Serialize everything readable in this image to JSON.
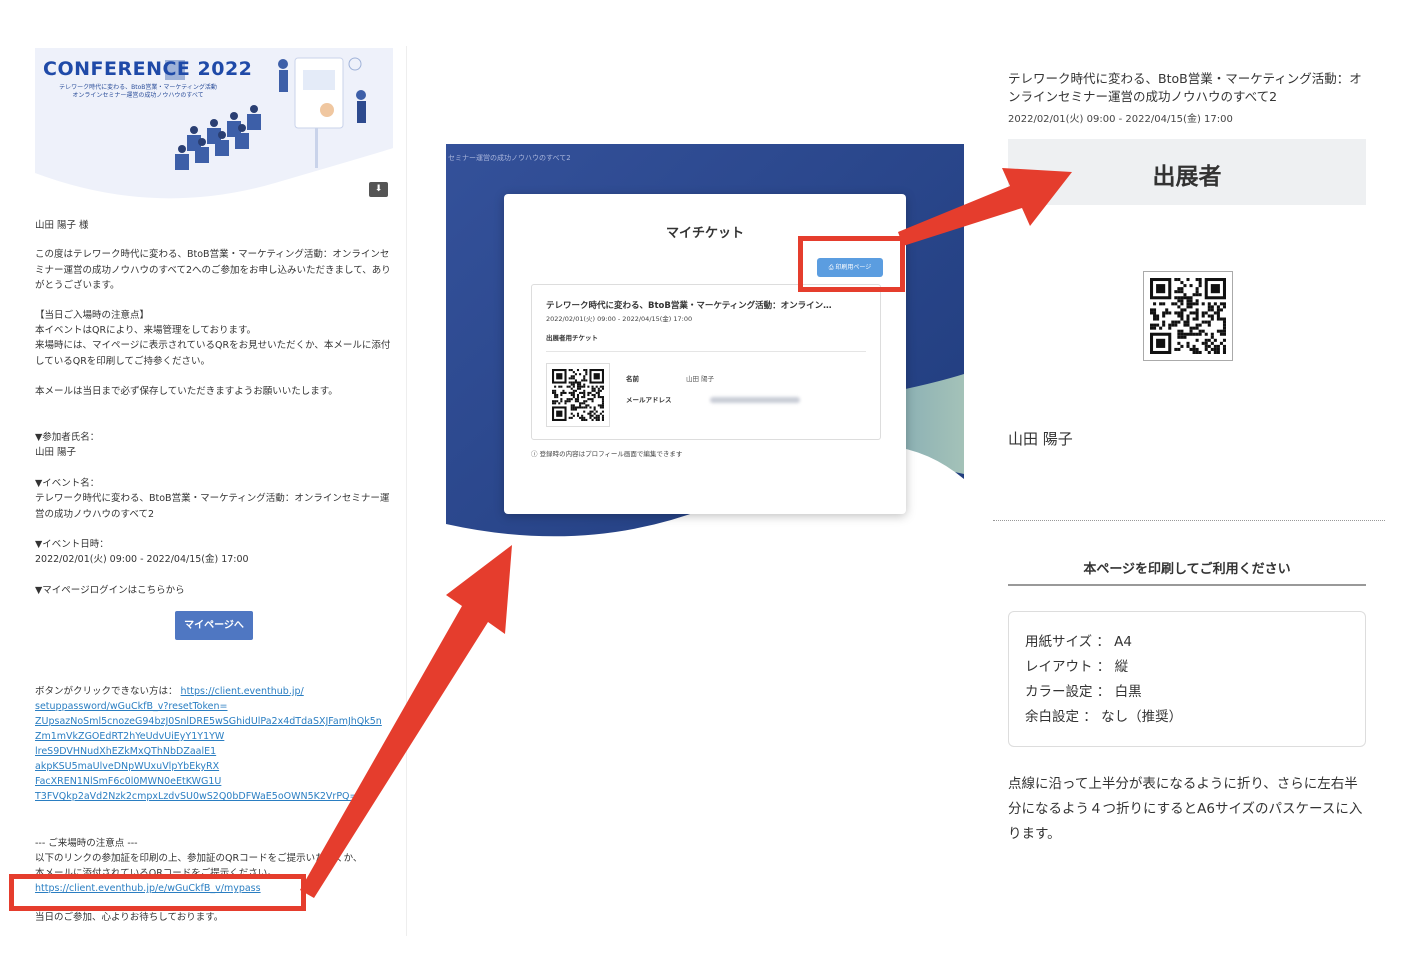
{
  "email": {
    "banner": {
      "title": "CONFERENCE 2022",
      "subtitle_1": "テレワーク時代に変わる、BtoB営業・マーケティング活動",
      "subtitle_2": "オンラインセミナー運営の成功ノウハウのすべて"
    },
    "salutation": "山田 陽子 様",
    "intro": "この度はテレワーク時代に変わる、BtoB営業・マーケティング活動：オンラインセミナー運営の成功ノウハウのすべて2へのご参加をお申し込みいただきまして、ありがとうございます。",
    "notice_heading": "【当日ご入場時の注意点】",
    "notice_line_1": "本イベントはQRにより、来場管理をしております。",
    "notice_line_2": "来場時には、マイページに表示されているQRをお見せいただくか、本メールに添付しているQRを印刷してご持参ください。",
    "keep_mail": "本メールは当日まで必ず保存していただきますようお願いいたします。",
    "participant_label": "▼参加者氏名：",
    "participant_value": "山田 陽子",
    "event_label": "▼イベント名：",
    "event_value": "テレワーク時代に変わる、BtoB営業・マーケティング活動：オンラインセミナー運営の成功ノウハウのすべて2",
    "date_label": "▼イベント日時：",
    "date_value": "2022/02/01(火) 09:00 - 2022/04/15(金) 17:00",
    "login_label": "▼マイページログインはこちらから",
    "mypage_button": "マイページへ",
    "no_click_prefix": "ボタンがクリックできない方は：",
    "reset_url_lines": [
      "https://client.eventhub.jp/",
      "setuppassword/wGuCkfB_v?resetToken=",
      "ZUpsazNoSml5cnozeG94bzJ0SnlDRE5wSGhidUlPa2x4dTdaSXJFamJhQk5n",
      "Zm1mVkZGOEdRT2hYeUdvUiEyY1Y1YW",
      "lreS9DVHNudXhEZkMxQThNbDZaalE1",
      "akpKSU5maUlveDNpWUxuVlpYbEkyRX",
      "FacXREN1NlSmF6c0l0MWN0eEtKWG1U",
      "T3FVQkp2aVd2Nzk2cmpxLzdvSU0wS2Q0bDFWaE5oOWN5K2VrPQ=="
    ],
    "visit_heading": "--- ご来場時の注意点 ---",
    "visit_line_1": "以下のリンクの参加証を印刷の上、参加証のQRコードをご提示いただくか、",
    "visit_line_2": "本メールに添付されているQRコードをご提示ください。",
    "mypass_url": "https://client.eventhub.jp/e/wGuCkfB_v/mypass",
    "closing": "当日のご参加、心よりお待ちしております。"
  },
  "ticket": {
    "breadcrumb": "セミナー運営の成功ノウハウのすべて2",
    "title": "マイチケット",
    "print_button": "印刷用ページ",
    "event_name": "テレワーク時代に変わる、BtoB営業・マーケティング活動：オンライン…",
    "event_date": "2022/02/01(火) 09:00 - 2022/04/15(金) 17:00",
    "ticket_type": "出展者用チケット",
    "name_label": "名前",
    "name_value": "山田 陽子",
    "email_label": "メールアドレス",
    "note": "ⓘ 登録時の内容はプロフィール画面で編集できます"
  },
  "print_page": {
    "event_title": "テレワーク時代に変わる、BtoB営業・マーケティング活動：オンラインセミナー運営の成功ノウハウのすべて2",
    "event_date": "2022/02/01(火) 09:00 - 2022/04/15(金) 17:00",
    "category": "出展者",
    "name": "山田 陽子",
    "print_heading": "本ページを印刷してご利用ください",
    "settings": [
      "用紙サイズ ： A4",
      "レイアウト ： 縦",
      "カラー設定 ： 白黒",
      "余白設定 ： なし（推奨）"
    ],
    "fold_note": "点線に沿って上半分が表になるように折り、さらに左右半分になるよう４つ折りにするとA6サイズのパスケースに入ります。"
  },
  "colors": {
    "highlight": "#e53d2d",
    "button_blue": "#4f77c2",
    "link": "#2a7ec2",
    "navy": "#2d4a8e"
  }
}
